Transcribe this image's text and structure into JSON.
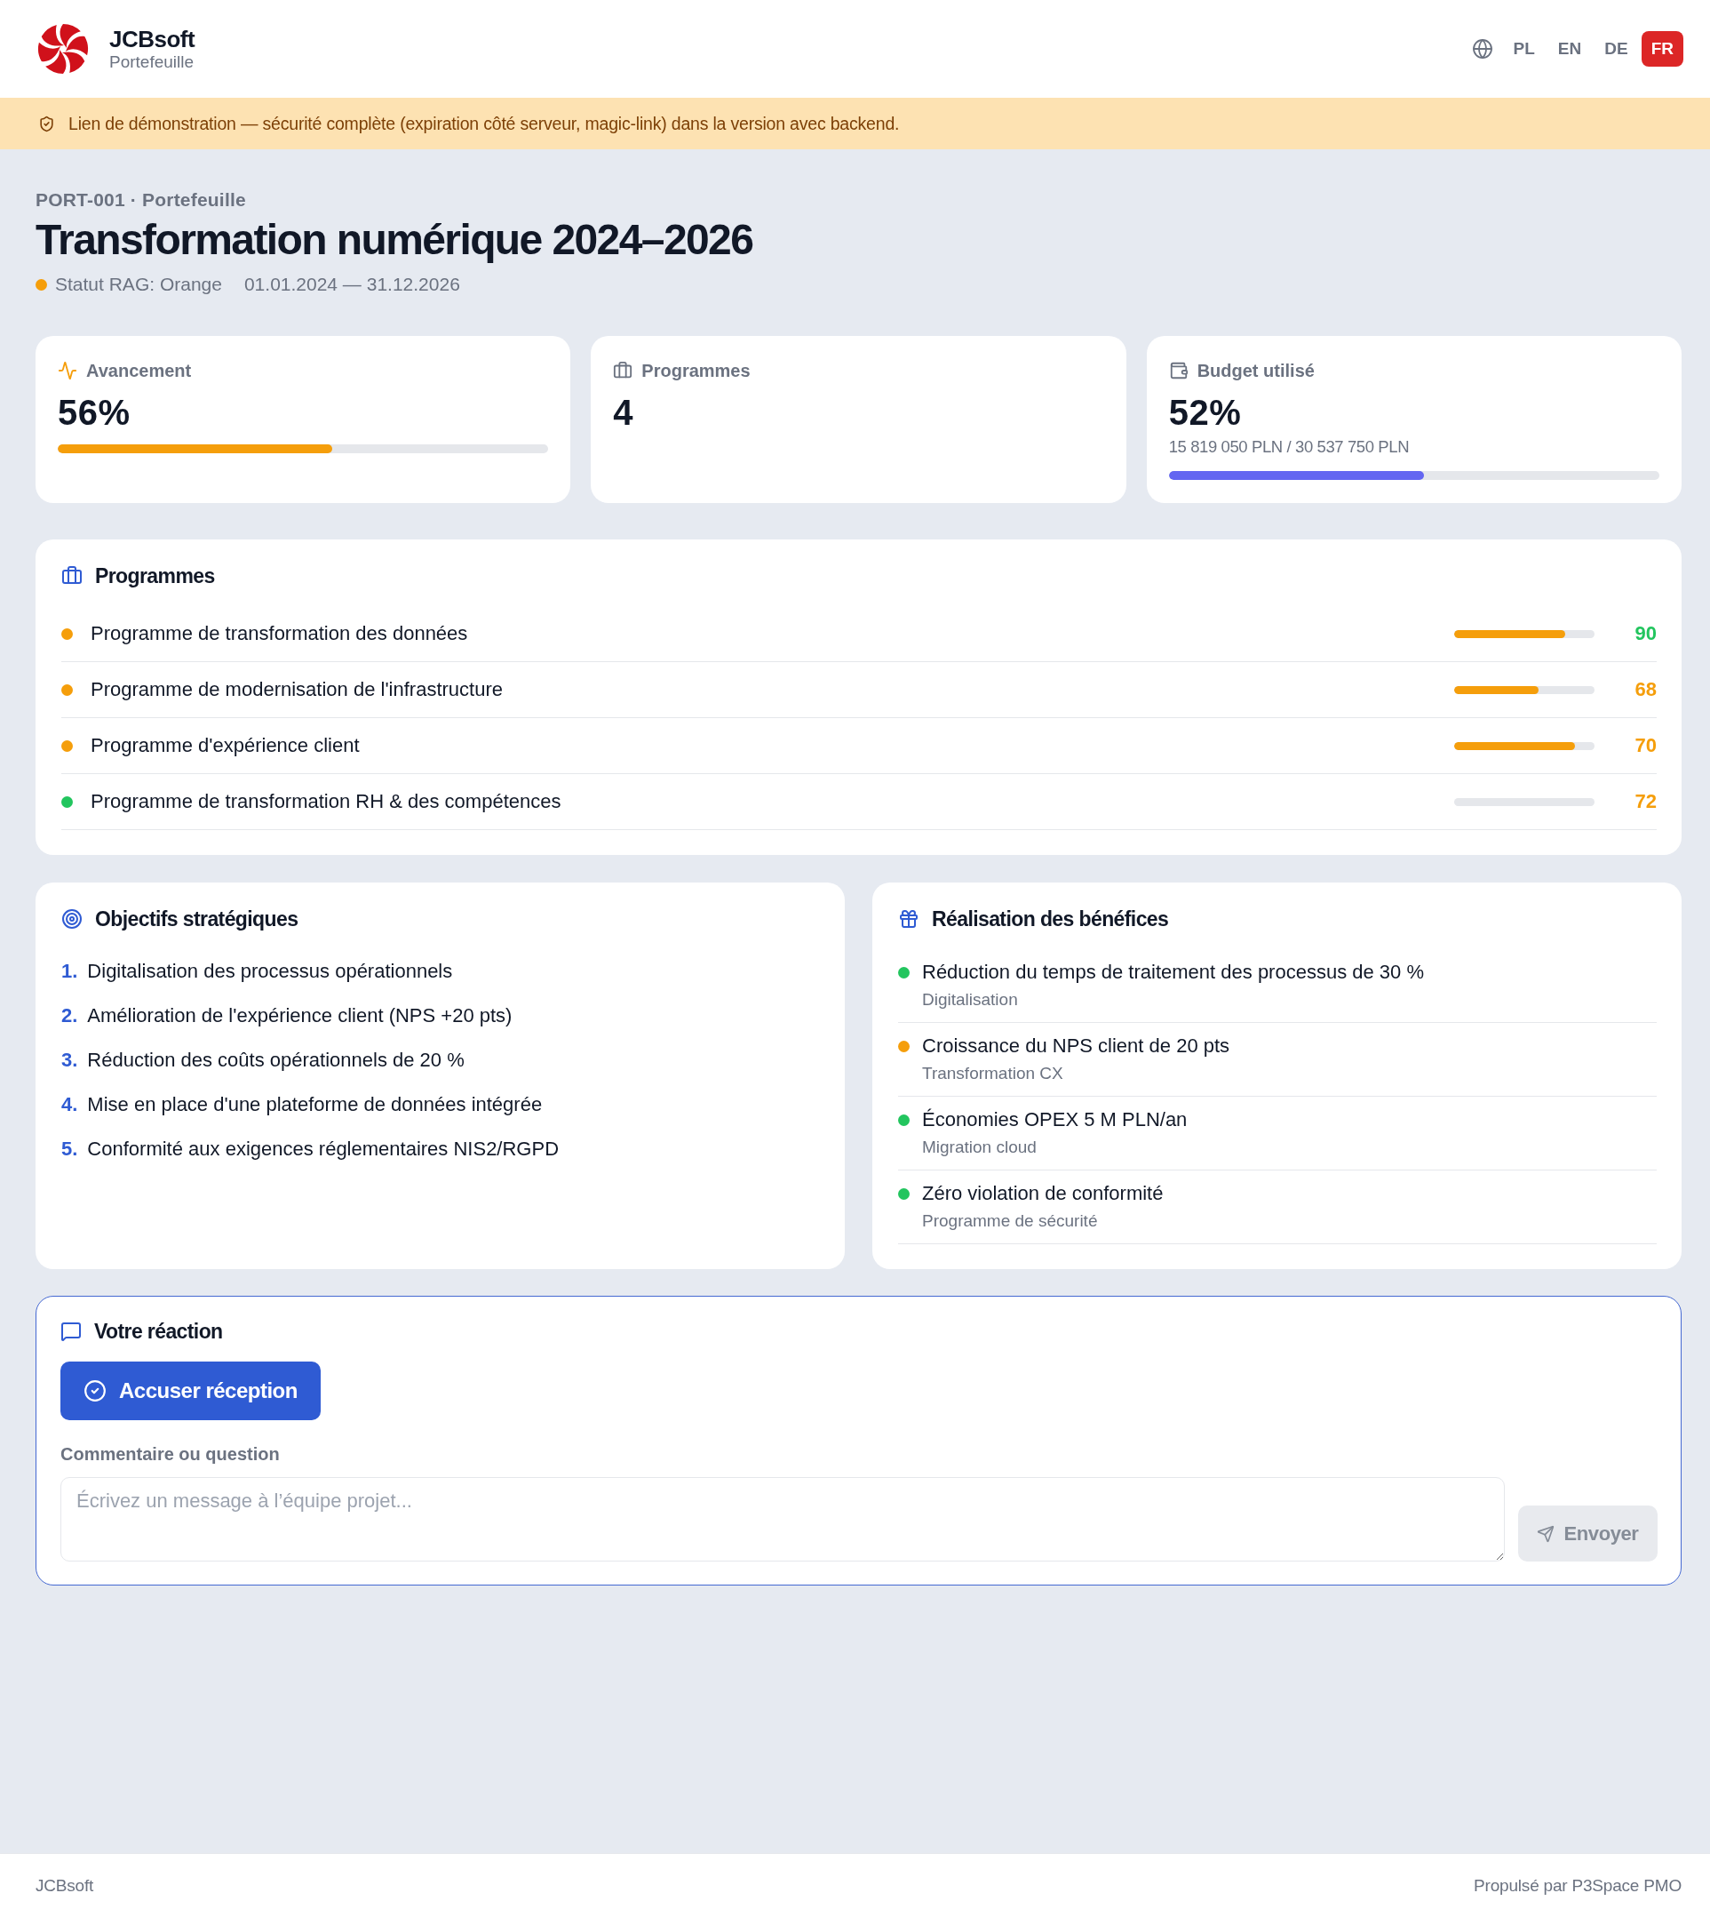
{
  "header": {
    "brand": "JCBsoft",
    "subtitle": "Portefeuille",
    "languages": [
      {
        "label": "PL",
        "selected": false
      },
      {
        "label": "EN",
        "selected": false
      },
      {
        "label": "DE",
        "selected": false
      },
      {
        "label": "FR",
        "selected": true
      }
    ]
  },
  "banner": {
    "text": "Lien de démonstration — sécurité complète (expiration côté serveur, magic-link) dans la version avec backend."
  },
  "portfolio": {
    "breadcrumb": "PORT-001 · Portefeuille",
    "title": "Transformation numérique 2024–2026",
    "status": {
      "label": "Statut RAG: Orange",
      "color": "#f59e0b"
    },
    "dates": "01.01.2024 — 31.12.2026"
  },
  "kpis": [
    {
      "kind": "progress",
      "label": "Avancement",
      "value": "56%",
      "level": 0.56
    },
    {
      "kind": "count",
      "label": "Programmes",
      "value": "4"
    },
    {
      "kind": "budget",
      "label": "Budget utilisé",
      "value": "52%",
      "detail": "15 819 050 PLN / 30 537 750 PLN",
      "level": 0.52
    }
  ],
  "programs": {
    "title": "Programmes",
    "items": [
      {
        "name": "Programme de transformation des données",
        "color": "#f59e0b",
        "level": 0.79,
        "score": {
          "value": "90",
          "color": "#22c55e"
        }
      },
      {
        "name": "Programme de modernisation de l'infrastructure",
        "color": "#f59e0b",
        "level": 0.6,
        "score": {
          "value": "68",
          "color": "#f59e0b"
        }
      },
      {
        "name": "Programme d'expérience client",
        "color": "#f59e0b",
        "level": 0.86,
        "score": {
          "value": "70",
          "color": "#f59e0b"
        }
      },
      {
        "name": "Programme de transformation RH & des compétences",
        "color": "#22c55e",
        "level": 0,
        "score": {
          "value": "72",
          "color": "#f59e0b"
        }
      }
    ]
  },
  "objectives": {
    "title": "Objectifs stratégiques",
    "items": [
      {
        "number": "1.",
        "text": "Digitalisation des processus opérationnels"
      },
      {
        "number": "2.",
        "text": "Amélioration de l'expérience client (NPS +20 pts)"
      },
      {
        "number": "3.",
        "text": "Réduction des coûts opérationnels de 20 %"
      },
      {
        "number": "4.",
        "text": "Mise en place d'une plateforme de données intégrée"
      },
      {
        "number": "5.",
        "text": "Conformité aux exigences réglementaires NIS2/RGPD"
      }
    ]
  },
  "benefits": {
    "title": "Réalisation des bénéfices",
    "items": [
      {
        "title": "Réduction du temps de traitement des processus de 30 %",
        "source": "Digitalisation",
        "color": "#22c55e"
      },
      {
        "title": "Croissance du NPS client de 20 pts",
        "source": "Transformation CX",
        "color": "#f59e0b"
      },
      {
        "title": "Économies OPEX 5 M PLN/an",
        "source": "Migration cloud",
        "color": "#22c55e"
      },
      {
        "title": "Zéro violation de conformité",
        "source": "Programme de sécurité",
        "color": "#22c55e"
      }
    ]
  },
  "feedback": {
    "title": "Votre réaction",
    "acknowledge_button": "Accuser réception",
    "comment": {
      "label": "Commentaire ou question",
      "placeholder": "Écrivez un message à l’équipe projet..."
    },
    "send_button": {
      "label": "Envoyer",
      "disabled": true
    }
  },
  "footer": {
    "left": "JCBsoft",
    "right": "Propulsé par P3Space PMO"
  }
}
